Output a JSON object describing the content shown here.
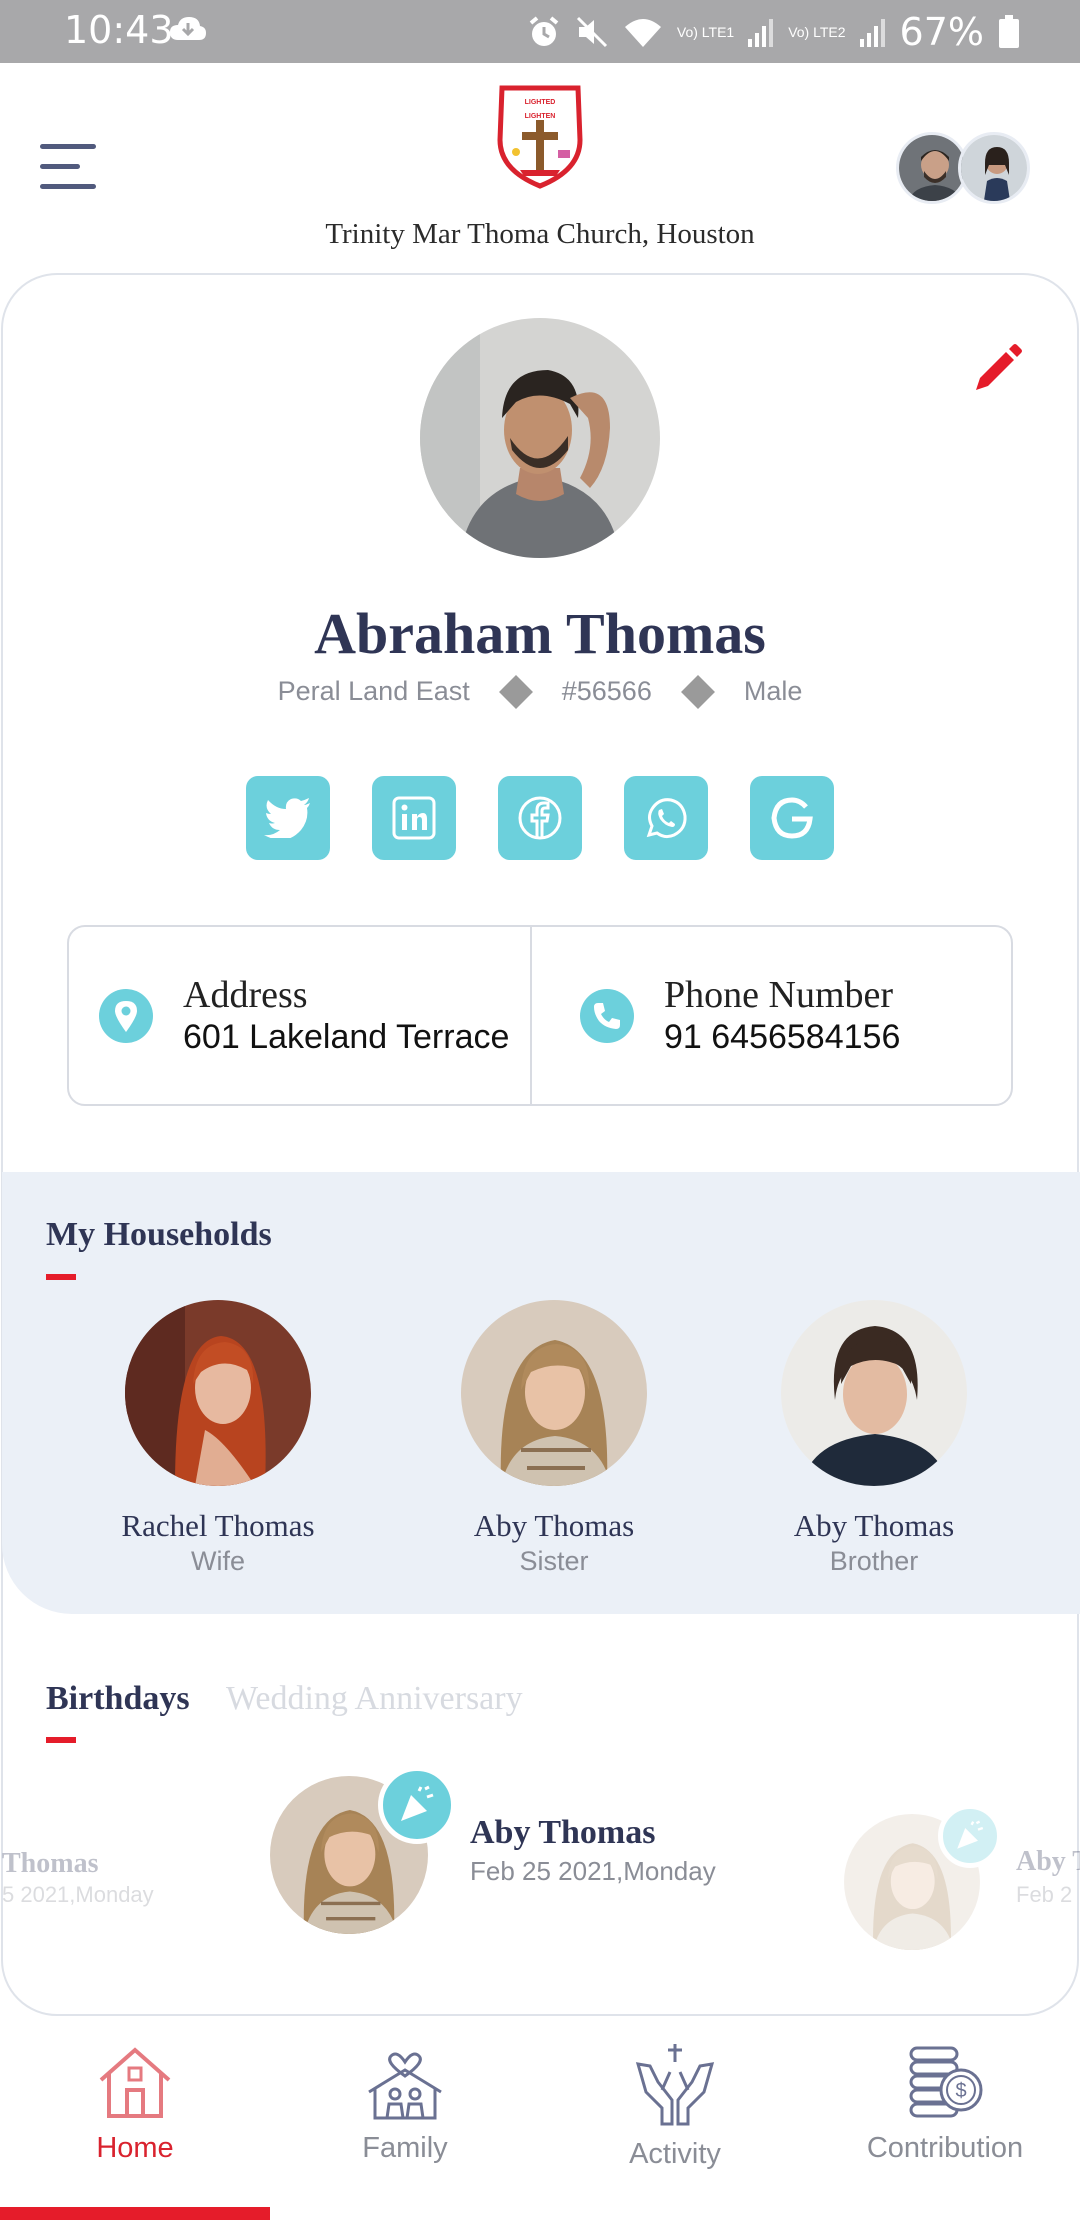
{
  "status_bar": {
    "time": "10:43",
    "battery": "67%",
    "sim1": "Vo) LTE1",
    "sim2": "Vo) LTE2"
  },
  "header": {
    "church_name": "Trinity Mar Thoma Church, Houston",
    "logo_text": "LIGHTED TO LIGHTEN"
  },
  "profile": {
    "name": "Abraham Thomas",
    "location": "Peral Land East",
    "member_id": "#56566",
    "gender": "Male"
  },
  "social_icons": [
    "twitter-icon",
    "linkedin-icon",
    "facebook-icon",
    "whatsapp-icon",
    "google-icon"
  ],
  "contact": {
    "address_label": "Address",
    "address_value": "601 Lakeland Terrace",
    "phone_label": "Phone Number",
    "phone_value": "91 6456584156"
  },
  "households": {
    "title": "My Households",
    "members": [
      {
        "name": "Rachel Thomas",
        "relation": "Wife"
      },
      {
        "name": "Aby Thomas",
        "relation": "Sister"
      },
      {
        "name": "Aby Thomas",
        "relation": "Brother"
      }
    ]
  },
  "events": {
    "tabs": [
      "Birthdays",
      "Wedding Anniversary"
    ],
    "active_tab": "Birthdays",
    "items": [
      {
        "name": "Thomas",
        "date": "5 2021,Monday"
      },
      {
        "name": "Aby Thomas",
        "date": "Feb 25 2021,Monday"
      },
      {
        "name": "Aby T",
        "date": "Feb 2"
      }
    ]
  },
  "bottom_nav": {
    "items": [
      "Home",
      "Family",
      "Activity",
      "Contribution"
    ],
    "active": "Home"
  },
  "colors": {
    "accent_red": "#e51c2a",
    "teal": "#6cd0dc",
    "navy": "#2f3555",
    "household_bg": "#ebf0f7"
  }
}
